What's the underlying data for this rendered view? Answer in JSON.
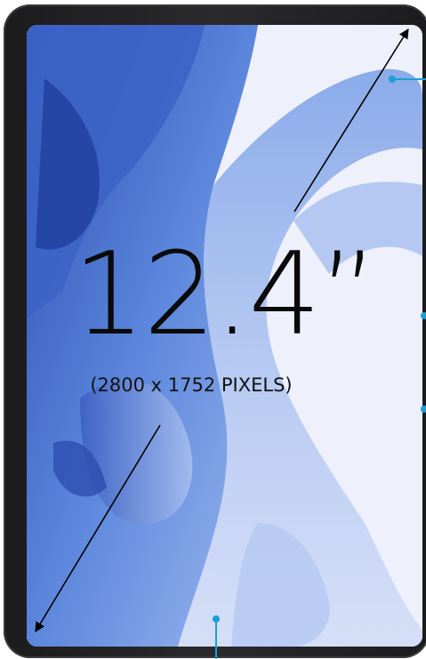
{
  "display": {
    "size_label": "12.4”",
    "resolution_label": "(2800 x 1752 PIXELS)"
  },
  "colors": {
    "callout_accent": "#1a9fd8",
    "bezel": "#1c1c1e",
    "wallpaper_blue": "#3b63c4"
  }
}
